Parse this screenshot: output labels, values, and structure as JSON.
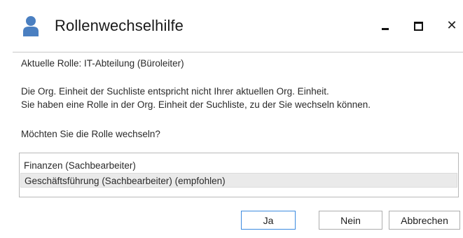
{
  "window": {
    "title": "Rollenwechselhilfe",
    "icon": "user-icon",
    "controls": {
      "minimize": "minimize-icon",
      "maximize": "maximize-icon",
      "close": "close-icon",
      "close_glyph": "✕"
    }
  },
  "content": {
    "current_role": "Aktuelle Rolle: IT-Abteilung (Büroleiter)",
    "message_line1": "Die Org. Einheit der Suchliste entspricht nicht Ihrer aktuellen Org. Einheit.",
    "message_line2": "Sie haben eine Rolle in der Org. Einheit der Suchliste, zu der Sie wechseln können.",
    "question": "Möchten Sie die Rolle wechseln?"
  },
  "roles": [
    {
      "label": "Finanzen (Sachbearbeiter)",
      "selected": false
    },
    {
      "label": "Geschäftsführung (Sachbearbeiter) (empfohlen)",
      "selected": true
    }
  ],
  "buttons": {
    "yes": "Ja",
    "no": "Nein",
    "cancel": "Abbrechen"
  },
  "colors": {
    "accent": "#3c8be0",
    "icon": "#4a7fc1",
    "selected_row": "#eaeaea",
    "border": "#b8b8b8"
  }
}
